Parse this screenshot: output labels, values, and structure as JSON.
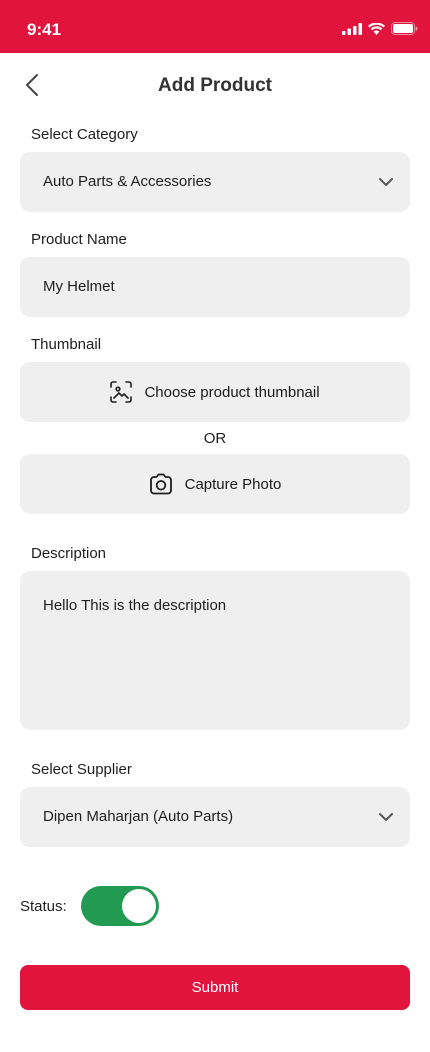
{
  "status_bar": {
    "time": "9:41",
    "bg_color": "#e0143c",
    "icons": [
      "signal-icon",
      "wifi-icon",
      "battery-icon"
    ]
  },
  "header": {
    "title": "Add Product",
    "back_icon": "back-arrow-icon"
  },
  "category": {
    "label": "Select Category",
    "value": "Auto Parts & Accessories"
  },
  "product_name": {
    "label": "Product Name",
    "value": "My Helmet"
  },
  "thumbnail": {
    "label": "Thumbnail",
    "choose_label": "Choose product thumbnail",
    "or_label": "OR",
    "capture_label": "Capture Photo"
  },
  "description": {
    "label": "Description",
    "value": "Hello This is the description"
  },
  "supplier": {
    "label": "Select Supplier",
    "value": "Dipen Maharjan (Auto Parts)"
  },
  "status": {
    "label": "Status:",
    "enabled": true,
    "on_color": "#229a52"
  },
  "submit": {
    "label": "Submit",
    "color": "#e0143c"
  }
}
